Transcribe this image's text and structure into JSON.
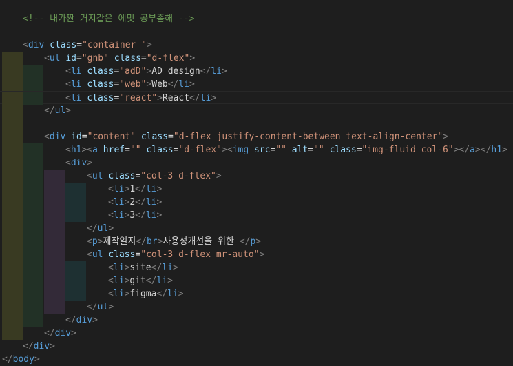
{
  "editor": {
    "lines": [
      {
        "indent": 0,
        "segments": [
          {
            "k": "c",
            "t": "<!-- 내가짠 거지같은 에밋 공부좀해 -->"
          }
        ]
      },
      {
        "indent": 0,
        "segments": []
      },
      {
        "indent": 0,
        "segments": [
          {
            "k": "p",
            "t": "<"
          },
          {
            "k": "t",
            "t": "div"
          },
          {
            "k": "x",
            "t": " "
          },
          {
            "k": "a",
            "t": "class"
          },
          {
            "k": "x",
            "t": "="
          },
          {
            "k": "v",
            "t": "\"container \""
          },
          {
            "k": "p",
            "t": ">"
          }
        ]
      },
      {
        "indent": 1,
        "segments": [
          {
            "k": "p",
            "t": "<"
          },
          {
            "k": "t",
            "t": "ul"
          },
          {
            "k": "x",
            "t": " "
          },
          {
            "k": "a",
            "t": "id"
          },
          {
            "k": "x",
            "t": "="
          },
          {
            "k": "v",
            "t": "\"gnb\""
          },
          {
            "k": "x",
            "t": " "
          },
          {
            "k": "a",
            "t": "class"
          },
          {
            "k": "x",
            "t": "="
          },
          {
            "k": "v",
            "t": "\"d-flex\""
          },
          {
            "k": "p",
            "t": ">"
          }
        ]
      },
      {
        "indent": 2,
        "segments": [
          {
            "k": "p",
            "t": "<"
          },
          {
            "k": "t",
            "t": "li"
          },
          {
            "k": "x",
            "t": " "
          },
          {
            "k": "a",
            "t": "class"
          },
          {
            "k": "x",
            "t": "="
          },
          {
            "k": "v",
            "t": "\"adD\""
          },
          {
            "k": "p",
            "t": ">"
          },
          {
            "k": "x",
            "t": "AD design"
          },
          {
            "k": "p",
            "t": "</"
          },
          {
            "k": "t",
            "t": "li"
          },
          {
            "k": "p",
            "t": ">"
          }
        ]
      },
      {
        "indent": 2,
        "segments": [
          {
            "k": "p",
            "t": "<"
          },
          {
            "k": "t",
            "t": "li"
          },
          {
            "k": "x",
            "t": " "
          },
          {
            "k": "a",
            "t": "class"
          },
          {
            "k": "x",
            "t": "="
          },
          {
            "k": "v",
            "t": "\"web\""
          },
          {
            "k": "p",
            "t": ">"
          },
          {
            "k": "x",
            "t": "Web"
          },
          {
            "k": "p",
            "t": "</"
          },
          {
            "k": "t",
            "t": "li"
          },
          {
            "k": "p",
            "t": ">"
          }
        ]
      },
      {
        "indent": 2,
        "current": true,
        "segments": [
          {
            "k": "p",
            "t": "<"
          },
          {
            "k": "t",
            "t": "li"
          },
          {
            "k": "x",
            "t": " "
          },
          {
            "k": "a",
            "t": "class"
          },
          {
            "k": "x",
            "t": "="
          },
          {
            "k": "v",
            "t": "\"react\""
          },
          {
            "k": "p",
            "t": ">"
          },
          {
            "k": "x",
            "t": "React"
          },
          {
            "k": "p",
            "t": "</"
          },
          {
            "k": "t",
            "t": "li"
          },
          {
            "k": "p",
            "t": ">"
          }
        ]
      },
      {
        "indent": 1,
        "segments": [
          {
            "k": "p",
            "t": "</"
          },
          {
            "k": "t",
            "t": "ul"
          },
          {
            "k": "p",
            "t": ">"
          }
        ]
      },
      {
        "indent": 1,
        "segments": []
      },
      {
        "indent": 1,
        "segments": [
          {
            "k": "p",
            "t": "<"
          },
          {
            "k": "t",
            "t": "div"
          },
          {
            "k": "x",
            "t": " "
          },
          {
            "k": "a",
            "t": "id"
          },
          {
            "k": "x",
            "t": "="
          },
          {
            "k": "v",
            "t": "\"content\""
          },
          {
            "k": "x",
            "t": " "
          },
          {
            "k": "a",
            "t": "class"
          },
          {
            "k": "x",
            "t": "="
          },
          {
            "k": "v",
            "t": "\"d-flex justify-content-between text-align-center\""
          },
          {
            "k": "p",
            "t": ">"
          }
        ]
      },
      {
        "indent": 2,
        "segments": [
          {
            "k": "p",
            "t": "<"
          },
          {
            "k": "t",
            "t": "h1"
          },
          {
            "k": "p",
            "t": "><"
          },
          {
            "k": "t",
            "t": "a"
          },
          {
            "k": "x",
            "t": " "
          },
          {
            "k": "a",
            "t": "href"
          },
          {
            "k": "x",
            "t": "="
          },
          {
            "k": "v",
            "t": "\"\""
          },
          {
            "k": "x",
            "t": " "
          },
          {
            "k": "a",
            "t": "class"
          },
          {
            "k": "x",
            "t": "="
          },
          {
            "k": "v",
            "t": "\"d-flex\""
          },
          {
            "k": "p",
            "t": "><"
          },
          {
            "k": "t",
            "t": "img"
          },
          {
            "k": "x",
            "t": " "
          },
          {
            "k": "a",
            "t": "src"
          },
          {
            "k": "x",
            "t": "="
          },
          {
            "k": "v",
            "t": "\"\""
          },
          {
            "k": "x",
            "t": " "
          },
          {
            "k": "a",
            "t": "alt"
          },
          {
            "k": "x",
            "t": "="
          },
          {
            "k": "v",
            "t": "\"\""
          },
          {
            "k": "x",
            "t": " "
          },
          {
            "k": "a",
            "t": "class"
          },
          {
            "k": "x",
            "t": "="
          },
          {
            "k": "v",
            "t": "\"img-fluid col-6\""
          },
          {
            "k": "p",
            "t": "></"
          },
          {
            "k": "t",
            "t": "a"
          },
          {
            "k": "p",
            "t": "></"
          },
          {
            "k": "t",
            "t": "h1"
          },
          {
            "k": "p",
            "t": ">"
          }
        ]
      },
      {
        "indent": 2,
        "segments": [
          {
            "k": "p",
            "t": "<"
          },
          {
            "k": "t",
            "t": "div"
          },
          {
            "k": "p",
            "t": ">"
          }
        ]
      },
      {
        "indent": 3,
        "segments": [
          {
            "k": "p",
            "t": "<"
          },
          {
            "k": "t",
            "t": "ul"
          },
          {
            "k": "x",
            "t": " "
          },
          {
            "k": "a",
            "t": "class"
          },
          {
            "k": "x",
            "t": "="
          },
          {
            "k": "v",
            "t": "\"col-3 d-flex\""
          },
          {
            "k": "p",
            "t": ">"
          }
        ]
      },
      {
        "indent": 4,
        "segments": [
          {
            "k": "p",
            "t": "<"
          },
          {
            "k": "t",
            "t": "li"
          },
          {
            "k": "p",
            "t": ">"
          },
          {
            "k": "x",
            "t": "1"
          },
          {
            "k": "p",
            "t": "</"
          },
          {
            "k": "t",
            "t": "li"
          },
          {
            "k": "p",
            "t": ">"
          }
        ]
      },
      {
        "indent": 4,
        "segments": [
          {
            "k": "p",
            "t": "<"
          },
          {
            "k": "t",
            "t": "li"
          },
          {
            "k": "p",
            "t": ">"
          },
          {
            "k": "x",
            "t": "2"
          },
          {
            "k": "p",
            "t": "</"
          },
          {
            "k": "t",
            "t": "li"
          },
          {
            "k": "p",
            "t": ">"
          }
        ]
      },
      {
        "indent": 4,
        "segments": [
          {
            "k": "p",
            "t": "<"
          },
          {
            "k": "t",
            "t": "li"
          },
          {
            "k": "p",
            "t": ">"
          },
          {
            "k": "x",
            "t": "3"
          },
          {
            "k": "p",
            "t": "</"
          },
          {
            "k": "t",
            "t": "li"
          },
          {
            "k": "p",
            "t": ">"
          }
        ]
      },
      {
        "indent": 3,
        "segments": [
          {
            "k": "p",
            "t": "</"
          },
          {
            "k": "t",
            "t": "ul"
          },
          {
            "k": "p",
            "t": ">"
          }
        ]
      },
      {
        "indent": 3,
        "segments": [
          {
            "k": "p",
            "t": "<"
          },
          {
            "k": "t",
            "t": "p"
          },
          {
            "k": "p",
            "t": ">"
          },
          {
            "k": "x",
            "t": "제작일지"
          },
          {
            "k": "p",
            "t": "</"
          },
          {
            "k": "t",
            "t": "br"
          },
          {
            "k": "p",
            "t": ">"
          },
          {
            "k": "x",
            "t": "사용성개선을 위한 "
          },
          {
            "k": "p",
            "t": "</"
          },
          {
            "k": "t",
            "t": "p"
          },
          {
            "k": "p",
            "t": ">"
          }
        ]
      },
      {
        "indent": 3,
        "segments": [
          {
            "k": "p",
            "t": "<"
          },
          {
            "k": "t",
            "t": "ul"
          },
          {
            "k": "x",
            "t": " "
          },
          {
            "k": "a",
            "t": "class"
          },
          {
            "k": "x",
            "t": "="
          },
          {
            "k": "v",
            "t": "\"col-3 d-flex mr-auto\""
          },
          {
            "k": "p",
            "t": ">"
          }
        ]
      },
      {
        "indent": 4,
        "segments": [
          {
            "k": "p",
            "t": "<"
          },
          {
            "k": "t",
            "t": "li"
          },
          {
            "k": "p",
            "t": ">"
          },
          {
            "k": "x",
            "t": "site"
          },
          {
            "k": "p",
            "t": "</"
          },
          {
            "k": "t",
            "t": "li"
          },
          {
            "k": "p",
            "t": ">"
          }
        ]
      },
      {
        "indent": 4,
        "segments": [
          {
            "k": "p",
            "t": "<"
          },
          {
            "k": "t",
            "t": "li"
          },
          {
            "k": "p",
            "t": ">"
          },
          {
            "k": "x",
            "t": "git"
          },
          {
            "k": "p",
            "t": "</"
          },
          {
            "k": "t",
            "t": "li"
          },
          {
            "k": "p",
            "t": ">"
          }
        ]
      },
      {
        "indent": 4,
        "segments": [
          {
            "k": "p",
            "t": "<"
          },
          {
            "k": "t",
            "t": "li"
          },
          {
            "k": "p",
            "t": ">"
          },
          {
            "k": "x",
            "t": "figma"
          },
          {
            "k": "p",
            "t": "</"
          },
          {
            "k": "t",
            "t": "li"
          },
          {
            "k": "p",
            "t": ">"
          }
        ]
      },
      {
        "indent": 3,
        "segments": [
          {
            "k": "p",
            "t": "</"
          },
          {
            "k": "t",
            "t": "ul"
          },
          {
            "k": "p",
            "t": ">"
          }
        ]
      },
      {
        "indent": 2,
        "segments": [
          {
            "k": "p",
            "t": "</"
          },
          {
            "k": "t",
            "t": "div"
          },
          {
            "k": "p",
            "t": ">"
          }
        ]
      },
      {
        "indent": 1,
        "segments": [
          {
            "k": "p",
            "t": "</"
          },
          {
            "k": "t",
            "t": "div"
          },
          {
            "k": "p",
            "t": ">"
          }
        ]
      },
      {
        "indent": 0,
        "segments": [
          {
            "k": "p",
            "t": "</"
          },
          {
            "k": "t",
            "t": "div"
          },
          {
            "k": "p",
            "t": ">"
          }
        ]
      },
      {
        "indent": -1,
        "segments": [
          {
            "k": "p",
            "t": "</"
          },
          {
            "k": "t",
            "t": "body"
          },
          {
            "k": "p",
            "t": ">"
          }
        ]
      }
    ]
  },
  "theme": {
    "background": "#1e1e1e",
    "comment": "#6a9955",
    "tag": "#569cd6",
    "punctuation": "#808080",
    "attribute": "#9cdcfe",
    "string": "#ce9178",
    "text": "#d4d4d4"
  }
}
